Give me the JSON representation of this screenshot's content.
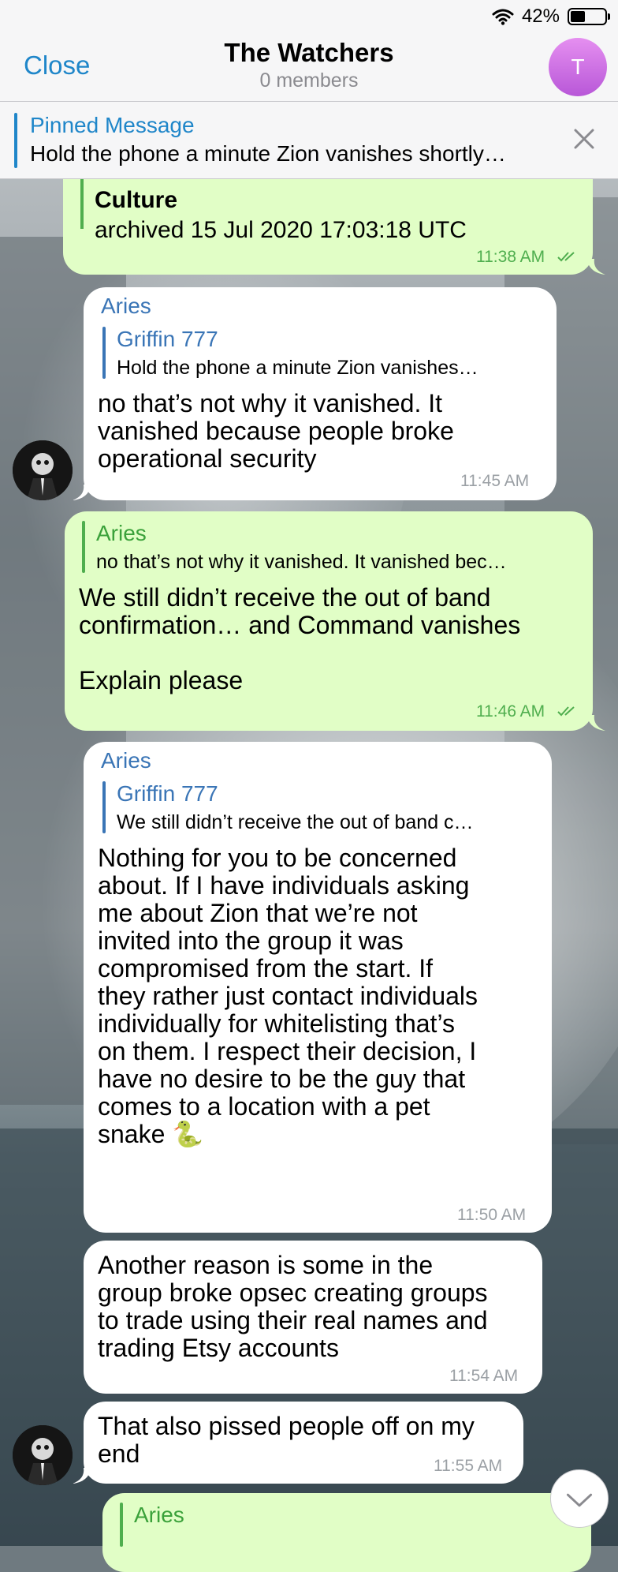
{
  "status": {
    "battery": "42%",
    "battery_level": 0.42
  },
  "header": {
    "close_label": "Close",
    "title": "The Watchers",
    "subtitle": "0 members",
    "avatar_letter": "T"
  },
  "pinned": {
    "title": "Pinned Message",
    "text": "Hold the phone a minute  Zion vanishes shortly…"
  },
  "messages": [
    {
      "line1": "Culture",
      "line2": "archived 15 Jul 2020 17:03:18 UTC",
      "time": "11:38 AM"
    },
    {
      "sender": "Aries",
      "quote_name": "Griffin 777",
      "quote_text": "Hold the phone a minute  Zion vanishes…",
      "text": "no that’s not why it vanished. It\nvanished because people broke\noperational security",
      "time": "11:45 AM"
    },
    {
      "quote_name": "Aries",
      "quote_text": "no that’s not why it vanished. It vanished bec…",
      "text": "We still didn’t receive the out of band\nconfirmation… and Command vanishes\n\nExplain please",
      "time": "11:46 AM"
    },
    {
      "sender": "Aries",
      "quote_name": "Griffin 777",
      "quote_text": "We still didn’t receive the out of band c…",
      "text": "Nothing for you to be concerned\nabout. If I have individuals asking\nme about Zion that we’re not\ninvited into the group it was\ncompromised from the start. If\nthey rather just contact individuals\nindividually for whitelisting that’s\non them.  I respect their decision, I\nhave no desire to be the guy that\ncomes to a location with a pet\nsnake 🐍",
      "time": "11:50 AM"
    },
    {
      "text": "Another reason is some in the\ngroup broke opsec creating groups\nto trade using their real names and\ntrading Etsy accounts",
      "time": "11:54 AM"
    },
    {
      "text": "That also pissed people off on my\nend",
      "time": "11:55 AM"
    },
    {
      "quote_name": "Aries"
    }
  ]
}
